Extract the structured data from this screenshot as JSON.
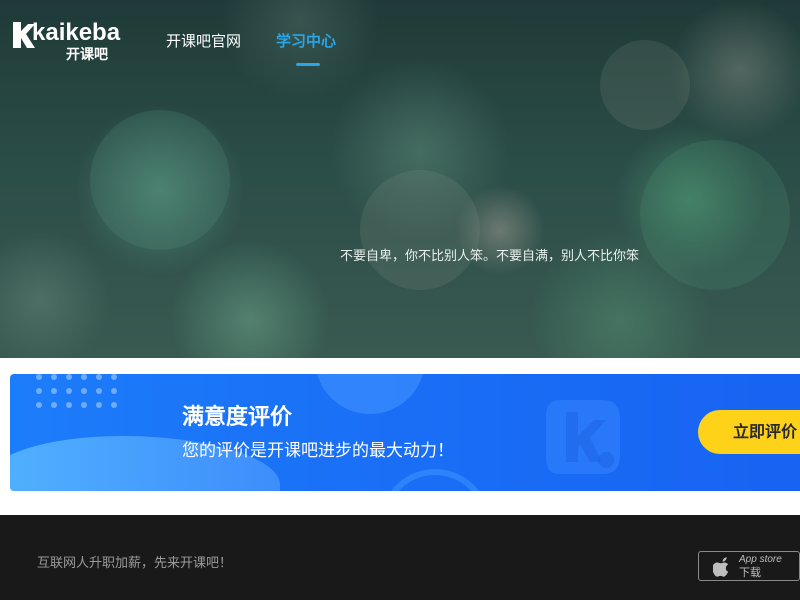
{
  "header": {
    "logo_text": "kaikeba",
    "logo_cn": "开课吧",
    "nav": [
      {
        "label": "开课吧官网",
        "active": false
      },
      {
        "label": "学习中心",
        "active": true
      }
    ],
    "accent_color": "#2aa5e8"
  },
  "hero": {
    "quote": "不要自卑，你不比别人笨。不要自满，别人不比你笨"
  },
  "banner": {
    "title": "满意度评价",
    "subtitle": "您的评价是开课吧进步的最大动力！",
    "button_label": "立即评价",
    "button_color": "#ffd21a",
    "background_color": "#1a6ff6",
    "logo_icon": "kaikeba-k-logo"
  },
  "footer": {
    "slogan": "互联网人升职加薪，先来开课吧！",
    "appstore_line1": "App store",
    "appstore_line2": "下载",
    "appstore_icon": "apple-icon"
  }
}
